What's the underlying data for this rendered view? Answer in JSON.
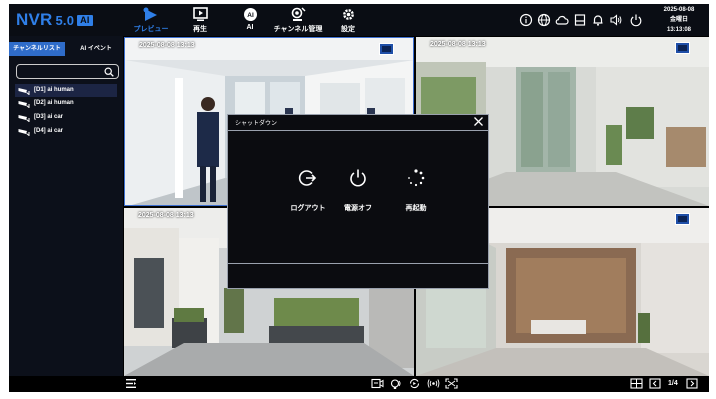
{
  "app": {
    "logo": "NVR",
    "version": "5.0",
    "badge": "AI"
  },
  "nav": [
    {
      "label": "プレビュー",
      "icon": "preview-icon"
    },
    {
      "label": "再生",
      "icon": "playback-icon"
    },
    {
      "label": "AI",
      "icon": "ai-icon"
    },
    {
      "label": "チャンネル管理",
      "icon": "channel-management-icon"
    },
    {
      "label": "設定",
      "icon": "settings-icon"
    }
  ],
  "status_icons": [
    "info-icon",
    "globe-icon",
    "cloud-icon",
    "disk-icon",
    "bell-icon",
    "volume-icon",
    "power-icon"
  ],
  "datetime": {
    "date": "2025-08-08",
    "weekday": "金曜日",
    "time": "13:13:08"
  },
  "sidebar": {
    "tabs": [
      "チャンネルリスト",
      "AI イベント"
    ],
    "search": {
      "value": "",
      "placeholder": ""
    },
    "channels": [
      {
        "label": "[D1] ai human"
      },
      {
        "label": "[D2] ai human"
      },
      {
        "label": "[D3] ai car"
      },
      {
        "label": "[D4] ai car"
      }
    ]
  },
  "grid": {
    "cells": [
      {
        "timestamp": "2025-08-08  13:13"
      },
      {
        "timestamp": "2025-08-08  13:13"
      },
      {
        "timestamp": "2025-08-08  13:13"
      },
      {
        "timestamp": ""
      }
    ]
  },
  "dialog": {
    "title": "シャットダウン",
    "buttons": [
      {
        "label": "ログアウト",
        "icon": "logout-icon"
      },
      {
        "label": "電源オフ",
        "icon": "power-off-icon"
      },
      {
        "label": "再起動",
        "icon": "restart-icon"
      }
    ]
  },
  "bottombar": {
    "page": "1/4"
  },
  "colors": {
    "accent": "#2f7fe8",
    "topbar": "#0a0d14",
    "sidebar": "#0c101a",
    "dialog": "#0b0c10"
  }
}
